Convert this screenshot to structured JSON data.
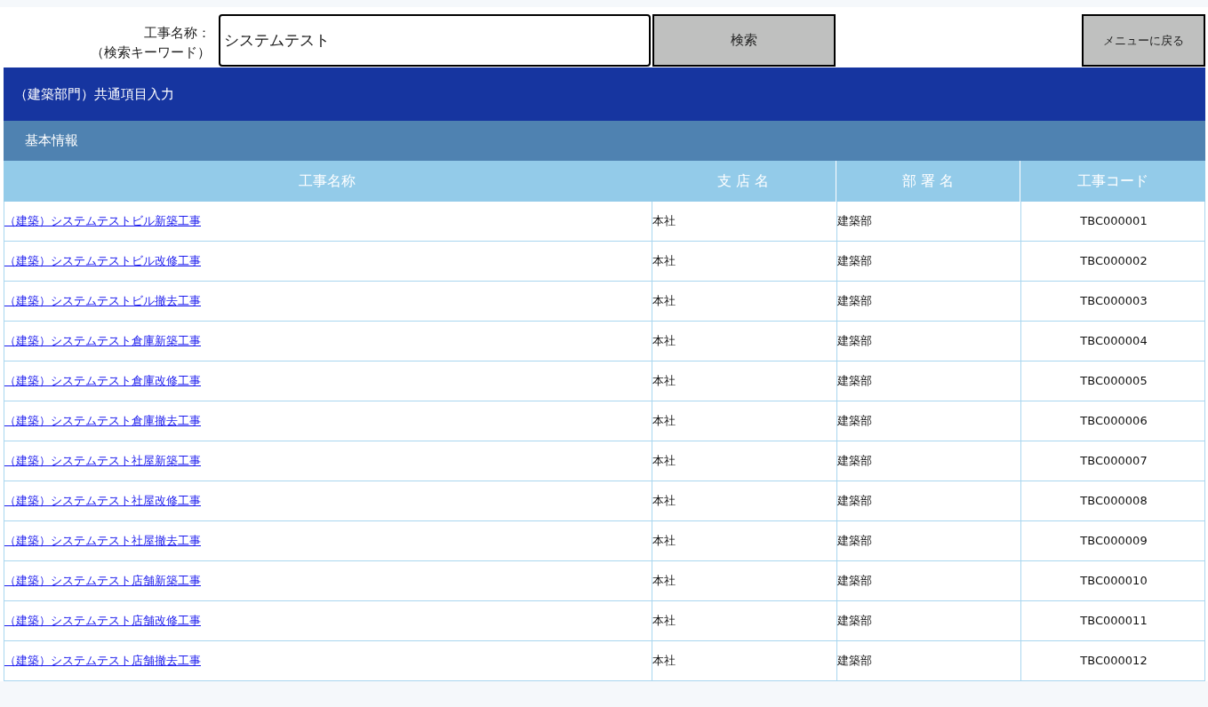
{
  "search": {
    "label_line1": "工事名称：",
    "label_line2": "（検索キーワード）",
    "value": "システムテスト",
    "button": "検索"
  },
  "menu_button": "メニューに戻る",
  "title_bar": "（建築部門）共通項目入力",
  "section_bar": "基本情報",
  "table": {
    "columns": [
      "工事名称",
      "支 店 名",
      "部 署 名",
      "工事コード"
    ],
    "rows": [
      {
        "name": "（建築）システムテストビル新築工事",
        "branch": "本社",
        "department": "建築部",
        "code": "TBC000001"
      },
      {
        "name": "（建築）システムテストビル改修工事",
        "branch": "本社",
        "department": "建築部",
        "code": "TBC000002"
      },
      {
        "name": "（建築）システムテストビル撤去工事",
        "branch": "本社",
        "department": "建築部",
        "code": "TBC000003"
      },
      {
        "name": "（建築）システムテスト倉庫新築工事",
        "branch": "本社",
        "department": "建築部",
        "code": "TBC000004"
      },
      {
        "name": "（建築）システムテスト倉庫改修工事",
        "branch": "本社",
        "department": "建築部",
        "code": "TBC000005"
      },
      {
        "name": "（建築）システムテスト倉庫撤去工事",
        "branch": "本社",
        "department": "建築部",
        "code": "TBC000006"
      },
      {
        "name": "（建築）システムテスト社屋新築工事",
        "branch": "本社",
        "department": "建築部",
        "code": "TBC000007"
      },
      {
        "name": "（建築）システムテスト社屋改修工事",
        "branch": "本社",
        "department": "建築部",
        "code": "TBC000008"
      },
      {
        "name": "（建築）システムテスト社屋撤去工事",
        "branch": "本社",
        "department": "建築部",
        "code": "TBC000009"
      },
      {
        "name": "（建築）システムテスト店舗新築工事",
        "branch": "本社",
        "department": "建築部",
        "code": "TBC000010"
      },
      {
        "name": "（建築）システムテスト店舗改修工事",
        "branch": "本社",
        "department": "建築部",
        "code": "TBC000011"
      },
      {
        "name": "（建築）システムテスト店舗撤去工事",
        "branch": "本社",
        "department": "建築部",
        "code": "TBC000012"
      }
    ]
  }
}
